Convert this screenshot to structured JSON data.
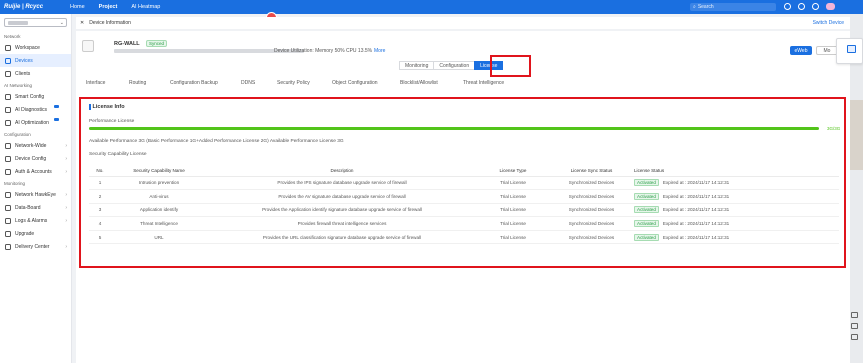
{
  "topbar": {
    "logo": "Ruijie | Rcycc",
    "nav": [
      "Home",
      "Project",
      "AI Heatmap"
    ],
    "active_nav": "Project",
    "search_placeholder": "Search"
  },
  "sidebar": {
    "sections": [
      {
        "label": "Network",
        "items": [
          {
            "label": "Workspace",
            "icon": "workspace-icon"
          },
          {
            "label": "Devices",
            "icon": "devices-icon",
            "active": true
          },
          {
            "label": "Clients",
            "icon": "clients-icon"
          }
        ]
      },
      {
        "label": "AI Networking",
        "items": [
          {
            "label": "Smart Config",
            "icon": "smart-config-icon"
          },
          {
            "label": "AI Diagnostics",
            "icon": "ai-diagnostics-icon"
          },
          {
            "label": "AI Optimization",
            "icon": "ai-optimization-icon"
          }
        ]
      },
      {
        "label": "Configuration",
        "items": [
          {
            "label": "Network-Wide",
            "icon": "network-wide-icon"
          },
          {
            "label": "Device Config",
            "icon": "device-config-icon"
          },
          {
            "label": "Auth & Accounts",
            "icon": "auth-icon"
          }
        ]
      },
      {
        "label": "Monitoring",
        "items": [
          {
            "label": "Network HawkEye",
            "icon": "hawkeye-icon"
          },
          {
            "label": "Data-Board",
            "icon": "data-board-icon"
          },
          {
            "label": "Logs & Alarms",
            "icon": "logs-icon"
          },
          {
            "label": "Upgrade",
            "icon": "upgrade-icon"
          },
          {
            "label": "Delivery Center",
            "icon": "delivery-icon"
          }
        ]
      }
    ]
  },
  "breadcrumb": {
    "title": "Device Information",
    "switch_device": "Switch Device"
  },
  "device": {
    "name": "RG-WALL",
    "status": "Synced",
    "utilization": "Device Utilization: Memory 50% CPU 13.5%",
    "more": "More",
    "eweb": "eWeb",
    "more_button": "Mo"
  },
  "main_tabs": [
    "Monitoring",
    "Configuration",
    "License"
  ],
  "active_main_tab": "License",
  "sub_tabs": [
    "Interface",
    "Routing",
    "Configuration Backup",
    "DDNS",
    "Security Policy",
    "Object Configuration",
    "Blocklist/Allowlist",
    "Threat Intelligence"
  ],
  "license": {
    "title": "License Info",
    "performance_label": "Performance License",
    "progress_fraction": 1.0,
    "progress_text": "3G/3G",
    "available_text": "Available Performance 3G   (Basic Performance 1G+Added Performance License 2G)  Available Performance License 3G",
    "security_label": "Security Capability License",
    "table": {
      "headers": [
        "No.",
        "Security Capability Name",
        "Description",
        "License Type",
        "License Sync Status",
        "License Status"
      ],
      "rows": [
        {
          "no": "1",
          "name": "Intrusion prevention",
          "desc": "Provides the IPS signature database upgrade service of firewall",
          "type": "Trial License",
          "sync": "Synchronized Devices",
          "status": "Activated",
          "expired": "Expired at :  2024/11/17 14:12:31"
        },
        {
          "no": "2",
          "name": "Anti-virus",
          "desc": "Provides the AV signature database upgrade service of firewall",
          "type": "Trial License",
          "sync": "Synchronized Devices",
          "status": "Activated",
          "expired": "Expired at :  2024/11/17 14:12:31"
        },
        {
          "no": "3",
          "name": "Application identify",
          "desc": "Provides the Application identify signature database upgrade service of firewall",
          "type": "Trial License",
          "sync": "Synchronized Devices",
          "status": "Activated",
          "expired": "Expired at :  2024/11/17 14:12:31"
        },
        {
          "no": "4",
          "name": "Threat Intelligence",
          "desc": "Provides firewall threat intelligence services",
          "type": "Trial License",
          "sync": "Synchronized Devices",
          "status": "Activated",
          "expired": "Expired at :  2024/11/17 14:12:31"
        },
        {
          "no": "5",
          "name": "URL",
          "desc": "Provides the URL classification signature database upgrade service of firewall",
          "type": "Trial License",
          "sync": "Synchronized Devices",
          "status": "Activated",
          "expired": "Expired at :  2024/11/17 14:12:31"
        }
      ]
    }
  }
}
